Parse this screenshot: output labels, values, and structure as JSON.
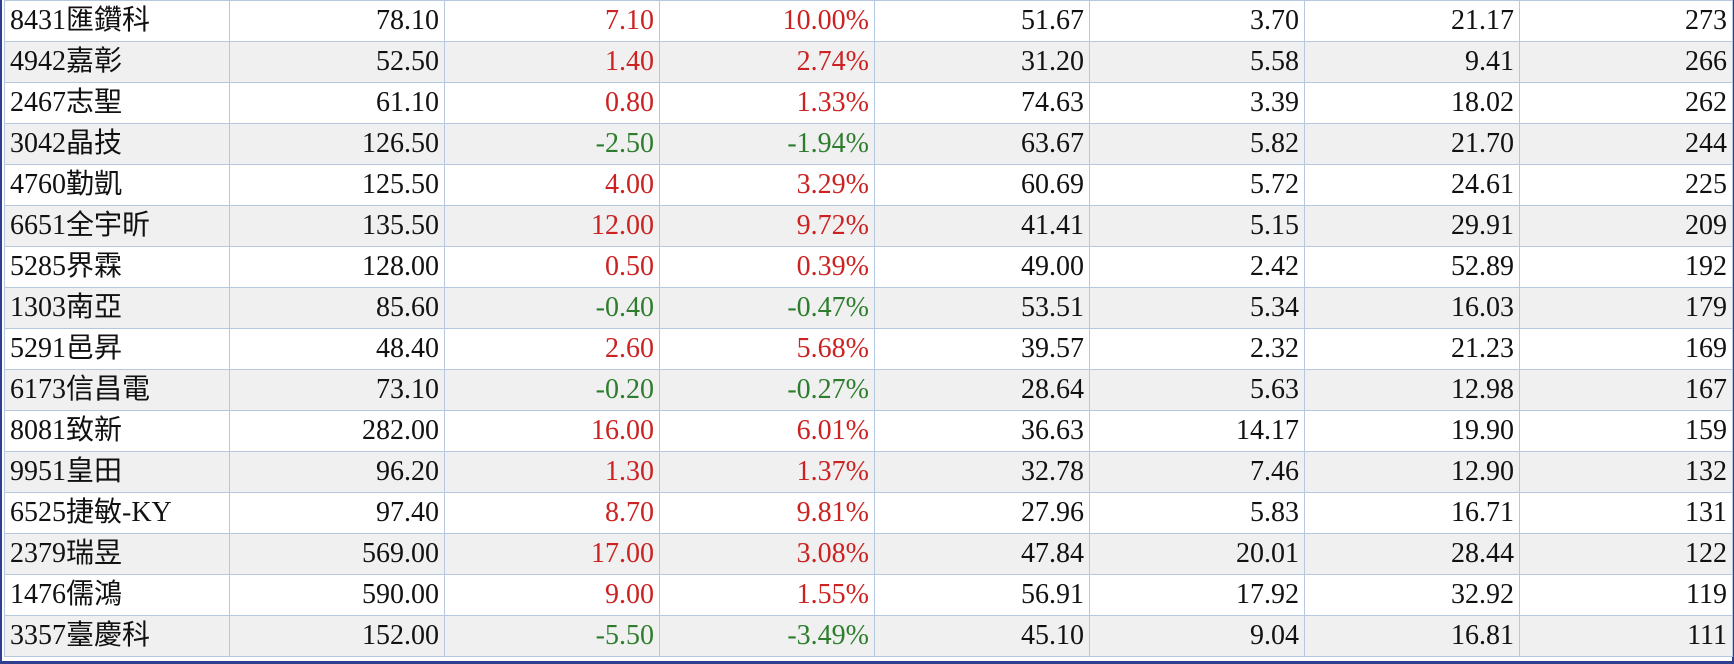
{
  "colors": {
    "up": "#cc2222",
    "down": "#2e7d2e",
    "grid": "#b5c8e0",
    "frame": "#2e3f8f",
    "stripe": "#f0f0f0"
  },
  "rows": [
    {
      "stock": "8431匯鑽科",
      "price": "78.10",
      "change": "7.10",
      "pct": "10.00%",
      "c4": "51.67",
      "c5": "3.70",
      "c6": "21.17",
      "c7": "273",
      "dir": "up"
    },
    {
      "stock": "4942嘉彰",
      "price": "52.50",
      "change": "1.40",
      "pct": "2.74%",
      "c4": "31.20",
      "c5": "5.58",
      "c6": "9.41",
      "c7": "266",
      "dir": "up"
    },
    {
      "stock": "2467志聖",
      "price": "61.10",
      "change": "0.80",
      "pct": "1.33%",
      "c4": "74.63",
      "c5": "3.39",
      "c6": "18.02",
      "c7": "262",
      "dir": "up"
    },
    {
      "stock": "3042晶技",
      "price": "126.50",
      "change": "-2.50",
      "pct": "-1.94%",
      "c4": "63.67",
      "c5": "5.82",
      "c6": "21.70",
      "c7": "244",
      "dir": "down"
    },
    {
      "stock": "4760勤凱",
      "price": "125.50",
      "change": "4.00",
      "pct": "3.29%",
      "c4": "60.69",
      "c5": "5.72",
      "c6": "24.61",
      "c7": "225",
      "dir": "up"
    },
    {
      "stock": "6651全宇昕",
      "price": "135.50",
      "change": "12.00",
      "pct": "9.72%",
      "c4": "41.41",
      "c5": "5.15",
      "c6": "29.91",
      "c7": "209",
      "dir": "up"
    },
    {
      "stock": "5285界霖",
      "price": "128.00",
      "change": "0.50",
      "pct": "0.39%",
      "c4": "49.00",
      "c5": "2.42",
      "c6": "52.89",
      "c7": "192",
      "dir": "up"
    },
    {
      "stock": "1303南亞",
      "price": "85.60",
      "change": "-0.40",
      "pct": "-0.47%",
      "c4": "53.51",
      "c5": "5.34",
      "c6": "16.03",
      "c7": "179",
      "dir": "down"
    },
    {
      "stock": "5291邑昇",
      "price": "48.40",
      "change": "2.60",
      "pct": "5.68%",
      "c4": "39.57",
      "c5": "2.32",
      "c6": "21.23",
      "c7": "169",
      "dir": "up"
    },
    {
      "stock": "6173信昌電",
      "price": "73.10",
      "change": "-0.20",
      "pct": "-0.27%",
      "c4": "28.64",
      "c5": "5.63",
      "c6": "12.98",
      "c7": "167",
      "dir": "down"
    },
    {
      "stock": "8081致新",
      "price": "282.00",
      "change": "16.00",
      "pct": "6.01%",
      "c4": "36.63",
      "c5": "14.17",
      "c6": "19.90",
      "c7": "159",
      "dir": "up"
    },
    {
      "stock": "9951皇田",
      "price": "96.20",
      "change": "1.30",
      "pct": "1.37%",
      "c4": "32.78",
      "c5": "7.46",
      "c6": "12.90",
      "c7": "132",
      "dir": "up"
    },
    {
      "stock": "6525捷敏-KY",
      "price": "97.40",
      "change": "8.70",
      "pct": "9.81%",
      "c4": "27.96",
      "c5": "5.83",
      "c6": "16.71",
      "c7": "131",
      "dir": "up"
    },
    {
      "stock": "2379瑞昱",
      "price": "569.00",
      "change": "17.00",
      "pct": "3.08%",
      "c4": "47.84",
      "c5": "20.01",
      "c6": "28.44",
      "c7": "122",
      "dir": "up"
    },
    {
      "stock": "1476儒鴻",
      "price": "590.00",
      "change": "9.00",
      "pct": "1.55%",
      "c4": "56.91",
      "c5": "17.92",
      "c6": "32.92",
      "c7": "119",
      "dir": "up"
    },
    {
      "stock": "3357臺慶科",
      "price": "152.00",
      "change": "-5.50",
      "pct": "-3.49%",
      "c4": "45.10",
      "c5": "9.04",
      "c6": "16.81",
      "c7": "111",
      "dir": "down"
    }
  ]
}
